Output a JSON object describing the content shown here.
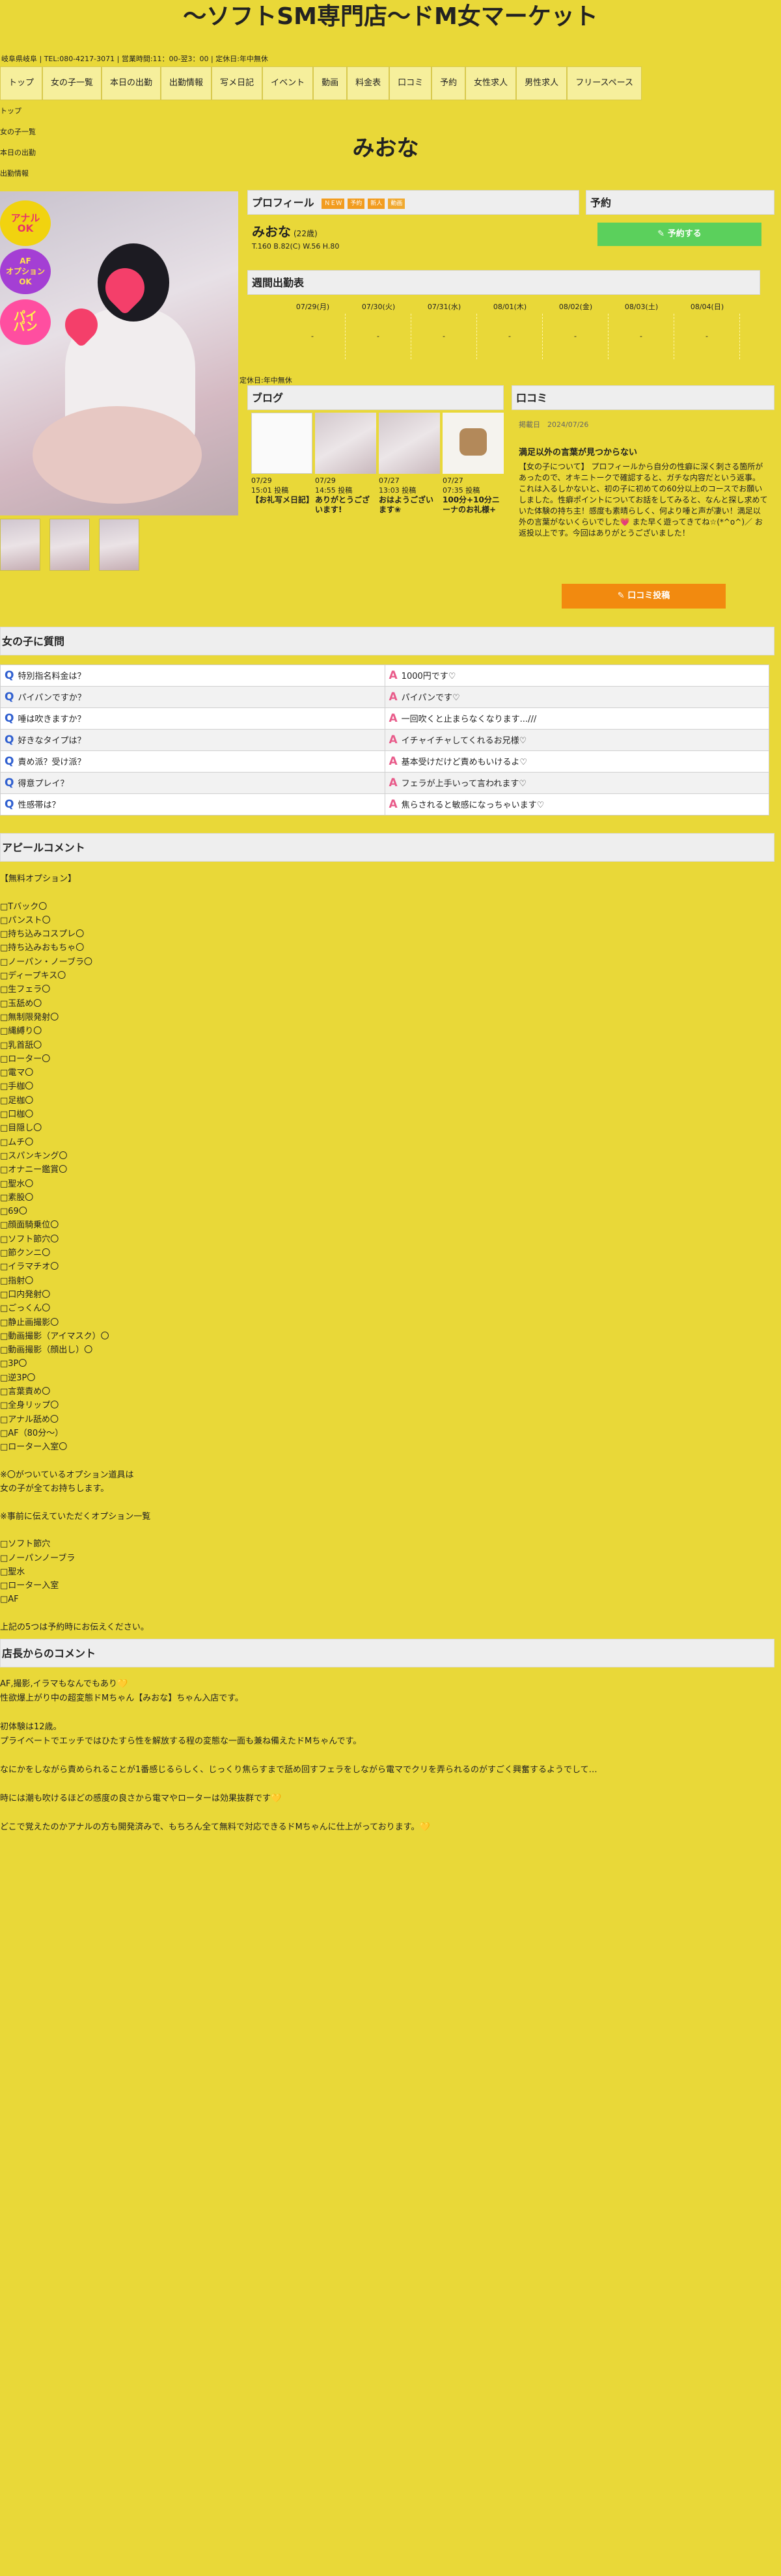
{
  "header": {
    "site_title": "〜ソフトSM専門店〜ドM女マーケット",
    "info": "岐阜県岐阜 | TEL:080-4217-3071 | 営業時間:11：00-翌3：00 | 定休日:年中無休"
  },
  "nav": [
    "トップ",
    "女の子一覧",
    "本日の出勤",
    "出勤情報",
    "写メ日記",
    "イベント",
    "動画",
    "料金表",
    "口コミ",
    "予約",
    "女性求人",
    "男性求人",
    "フリースペース"
  ],
  "mini_nav": [
    "トップ",
    "女の子一覧",
    "本日の出勤",
    "出勤情報"
  ],
  "girl_name_title": "みおな",
  "photo_badges": [
    "アナル\nOK",
    "AF\nオプション\nOK",
    "パイ\nパン"
  ],
  "profile": {
    "heading": "プロフィール",
    "tags": [
      "ＮＥＷ",
      "予約",
      "新人",
      "動画"
    ],
    "name": "みおな",
    "age": "(22歳)",
    "size": "T.160 B.82(C) W.56 H.80"
  },
  "reserve": {
    "heading": "予約",
    "button": "✎ 予約する"
  },
  "schedule": {
    "heading": "週間出勤表",
    "days": [
      {
        "date": "07/29(月)",
        "value": "-"
      },
      {
        "date": "07/30(火)",
        "value": "-"
      },
      {
        "date": "07/31(水)",
        "value": "-"
      },
      {
        "date": "08/01(木)",
        "value": "-"
      },
      {
        "date": "08/02(金)",
        "value": "-"
      },
      {
        "date": "08/03(土)",
        "value": "-"
      },
      {
        "date": "08/04(日)",
        "value": "-"
      }
    ],
    "closed_note": "定休日:年中無休"
  },
  "blog": {
    "heading": "ブログ",
    "items": [
      {
        "date": "07/29",
        "time": "15:01 投稿",
        "title": "【お礼写メ日記】"
      },
      {
        "date": "07/29",
        "time": "14:55 投稿",
        "title": "ありがとうございます!"
      },
      {
        "date": "07/27",
        "time": "13:03 投稿",
        "title": "おはようございます❀"
      },
      {
        "date": "07/27",
        "time": "07:35 投稿",
        "title": "100分+10分ニーナのお礼様+"
      }
    ]
  },
  "kuchikomi": {
    "heading": "口コミ",
    "date_label": "掲載日",
    "date": "2024/07/26",
    "title": "満足以外の言葉が見つからない",
    "body": "【女の子について】 プロフィールから自分の性癖に深く刺さる箇所があったので、オキニトークで確認すると、ガチな内容だという返事。これは入るしかないと、初の子に初めての60分以上のコースでお願いしました。性癖ポイントについてお話をしてみると、なんと探し求めていた体験の持ち主！感度も素晴らしく、何より唾と声が凄い！満足以外の言葉がないくらいでした💗 また早く遊ってきてね☆(*^o^)／ お返投以上です。今回はありがとうございました！",
    "button": "✎ 口コミ投稿"
  },
  "qa": {
    "heading": "女の子に質問",
    "rows": [
      {
        "q": "特別指名料金は？",
        "a": "1000円です♡"
      },
      {
        "q": "パイパンですか？",
        "a": "パイパンです♡"
      },
      {
        "q": "唾は吹きますか？",
        "a": "一回吹くと止まらなくなります...///"
      },
      {
        "q": "好きなタイプは？",
        "a": "イチャイチャしてくれるお兄様♡"
      },
      {
        "q": "責め派？受け派？",
        "a": "基本受けだけど責めもいけるよ♡"
      },
      {
        "q": "得意プレイ？",
        "a": "フェラが上手いって言われます♡"
      },
      {
        "q": "性感帯は？",
        "a": "焦らされると敏感になっちゃいます♡"
      }
    ]
  },
  "appeal": {
    "heading": "アピールコメント",
    "text": "【無料オプション】\n\n□Tバック〇\n□パンスト〇\n□持ち込みコスプレ〇\n□持ち込みおもちゃ〇\n□ノーパン・ノーブラ〇\n□ディープキス〇\n□生フェラ〇\n□玉舐め〇\n□無制限発射〇\n□縄縛り〇\n□乳首舐〇\n□ローター〇\n□電マ〇\n□手枷〇\n□足枷〇\n□口枷〇\n□目隠し〇\n□ムチ〇\n□スパンキング〇\n□オナニー鑑賞〇\n□聖水〇\n□素股〇\n□69〇\n□顔面騎乗位〇\n□ソフト節穴〇\n□節クンニ〇\n□イラマチオ〇\n□指射〇\n□口内発射〇\n□ごっくん〇\n□静止画撮影〇\n□動画撮影（アイマスク）〇\n□動画撮影（顔出し）〇\n□3P〇\n□逆3P〇\n□言葉責め〇\n□全身リップ〇\n□アナル舐め〇\n□AF（80分〜）\n□ローター入室〇\n\n※〇がついているオプション道具は\n女の子が全てお持ちします。\n\n※事前に伝えていただくオプション一覧\n\n□ソフト節穴\n□ノーパンノーブラ\n□聖水\n□ローター入室\n□AF\n\n上記の5つは予約時にお伝えください。"
  },
  "shop_comment": {
    "heading": "店長からのコメント",
    "text": "AF,撮影,イラマもなんでもあり💛\n性欲爆上がり中の超変態ドMちゃん【みおな】ちゃん入店です。\n\n初体験は12歳。\nプライベートでエッチではひたすら性を解放する程の変態な一面も兼ね備えたドMちゃんです。\n\nなにかをしながら責められることが1番感じるらしく、じっくり焦らすまで舐め回すフェラをしながら電マでクリを弄られるのがすごく興奮するようでして…\n\n時には潮も吹けるほどの感度の良さから電マやローターは効果抜群です💛\n\nどこで覚えたのかアナルの方も開発済みで、もちろん全て無料で対応できるドMちゃんに仕上がっております。💛"
  }
}
